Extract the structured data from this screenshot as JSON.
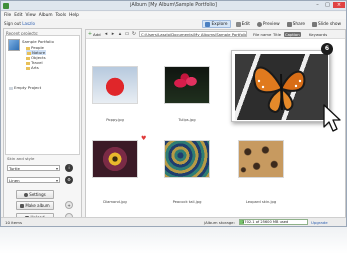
{
  "window": {
    "title": "jAlbum [My Album\\Sample Portfolio]",
    "controls": [
      "–",
      "□",
      "×"
    ]
  },
  "menu": [
    "File",
    "Edit",
    "View",
    "Album",
    "Tools",
    "Help"
  ],
  "left_header": {
    "text": "Sign out ",
    "user": "Laszlo"
  },
  "toolbar": {
    "explore": "Explore",
    "edit": "Edit",
    "preview": "Preview",
    "share": "Share",
    "slideshow": "Slide show"
  },
  "projects": {
    "title": "Recent projects:",
    "items": [
      {
        "name": "Sample Portfolio",
        "folders": [
          "People",
          "Nature",
          "Objects",
          "Travel",
          "Arts"
        ],
        "selected_folder": "Nature"
      },
      {
        "name": "Empty Project"
      }
    ]
  },
  "skin": {
    "title": "Skin and style",
    "skin_value": "Turtle",
    "style_value": "Linen",
    "settings_label": "Settings",
    "make_album_label": "Make album",
    "upload_label": "Upload"
  },
  "address": {
    "add_label": "Add",
    "path": "C:\\Users\\Laszlo\\Documents\\My Albums\\Sample Portfolio\\Nature",
    "sort_options": [
      "File name",
      "Title",
      "Caption",
      "Keywords"
    ],
    "sort_active": "Caption"
  },
  "thumbnails": [
    {
      "caption": "Poppy.jpg",
      "kind": "poppy"
    },
    {
      "caption": "Tulips.jpg",
      "kind": "tulip"
    },
    {
      "caption": "Diamond.jpg",
      "kind": "diamond"
    },
    {
      "caption": "Peacock tail.jpg",
      "kind": "peacock"
    },
    {
      "caption": "Leopard skin.jpg",
      "kind": "leopard"
    }
  ],
  "popup": {
    "badge": "6"
  },
  "status": {
    "items": "10 items",
    "storage_label": "jAlbum storage:",
    "storage_text": "1702.1 of 25600 MB used",
    "storage_fraction": 0.066,
    "upgrade": "Upgrade"
  }
}
